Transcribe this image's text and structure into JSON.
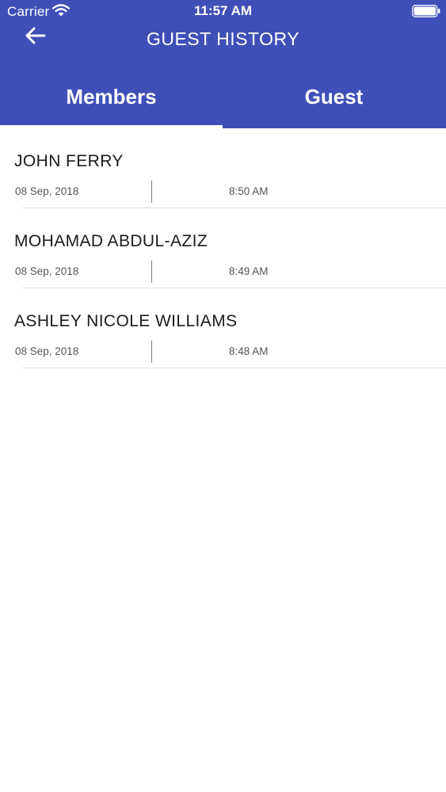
{
  "status_bar": {
    "carrier": "Carrier",
    "time": "11:57 AM",
    "wifi_icon": "wifi-icon",
    "battery_icon": "battery-icon"
  },
  "nav": {
    "title": "GUEST HISTORY",
    "back_icon": "back-arrow-icon"
  },
  "tabs": [
    {
      "label": "Members",
      "selected": true
    },
    {
      "label": "Guest",
      "selected": false
    }
  ],
  "entries": [
    {
      "name": "JOHN FERRY",
      "date": "08 Sep, 2018",
      "time": "8:50 AM"
    },
    {
      "name": "MOHAMAD ABDUL-AZIZ",
      "date": "08 Sep, 2018",
      "time": "8:49 AM"
    },
    {
      "name": "ASHLEY NICOLE WILLIAMS",
      "date": "08 Sep, 2018",
      "time": "8:48 AM"
    }
  ],
  "colors": {
    "header_bg": "#3e50b8",
    "tab_indicator": "#ffffff",
    "name_text": "#1b1b1b",
    "meta_text": "#555555"
  }
}
